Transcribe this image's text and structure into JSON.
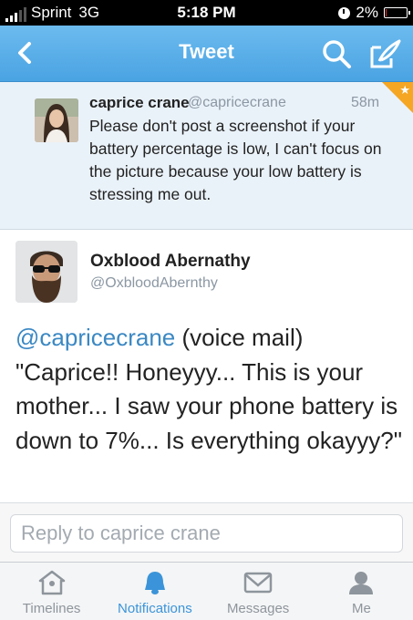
{
  "status_bar": {
    "carrier": "Sprint",
    "network": "3G",
    "time": "5:18 PM",
    "battery_percent": "2%",
    "battery_level": 0.02
  },
  "nav": {
    "title": "Tweet"
  },
  "parent_tweet": {
    "name": "caprice crane",
    "handle": "@capricecrane",
    "time": "58m",
    "text": "Please don't post a screenshot if your battery percentage is low, I can't focus on the picture because your low battery is stressing me out."
  },
  "main_tweet": {
    "name": "Oxblood Abernathy",
    "handle": "@OxbloodAbernthy",
    "mention": "@capricecrane",
    "text": " (voice mail) \"Caprice!! Honeyyy... This is your mother... I saw your phone battery is down to 7%... Is everything okayyy?\""
  },
  "reply": {
    "placeholder": "Reply to caprice crane"
  },
  "tabs": [
    {
      "label": "Timelines",
      "icon": "home-icon"
    },
    {
      "label": "Notifications",
      "icon": "bell-icon"
    },
    {
      "label": "Messages",
      "icon": "envelope-icon"
    },
    {
      "label": "Me",
      "icon": "person-icon"
    }
  ],
  "colors": {
    "nav_blue": "#4aa3e2",
    "link_blue": "#3b88c3",
    "active_tab": "#3b94d9",
    "corner_orange": "#f5a623",
    "battery_red": "#e0302b"
  }
}
